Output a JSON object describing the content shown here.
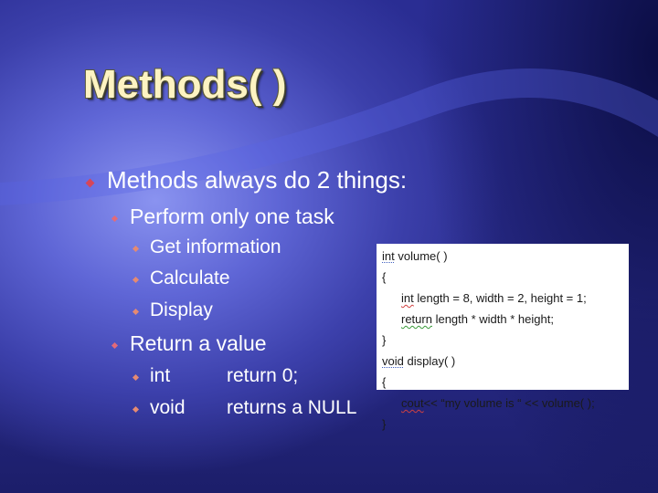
{
  "slide": {
    "title": "Methods( )",
    "colors": {
      "title": "#fdf3c2",
      "background_dark": "#0c0f45",
      "background_light": "#8a93f0",
      "bullet_level1": "#d6465a",
      "bullet_level2": "#e36a78",
      "bullet_level3": "#e58a72",
      "body_text": "#ffffff"
    },
    "bullets": {
      "main": "Methods always do 2 things:",
      "sub1": "Perform only one task",
      "sub1_items": [
        "Get information",
        "Calculate",
        "Display"
      ],
      "sub2": "Return a value",
      "sub2_items": [
        {
          "type": "int",
          "desc": "return 0;"
        },
        {
          "type": "void",
          "desc": "returns a NULL"
        }
      ]
    },
    "code": {
      "lines": [
        {
          "kw": "int",
          "rest": " volume( )"
        },
        {
          "text": "{"
        },
        {
          "kw": "int",
          "rest": " length = 8, width = 2, height = 1;"
        },
        {
          "kw": "return",
          "rest": " length * width * height;"
        },
        {
          "text": "}"
        },
        {
          "kw": "void",
          "rest": " display( )"
        },
        {
          "text": "{"
        },
        {
          "kw": "cout",
          "rest": "<< “my volume is “ << volume( );"
        },
        {
          "text": "}"
        }
      ]
    }
  }
}
